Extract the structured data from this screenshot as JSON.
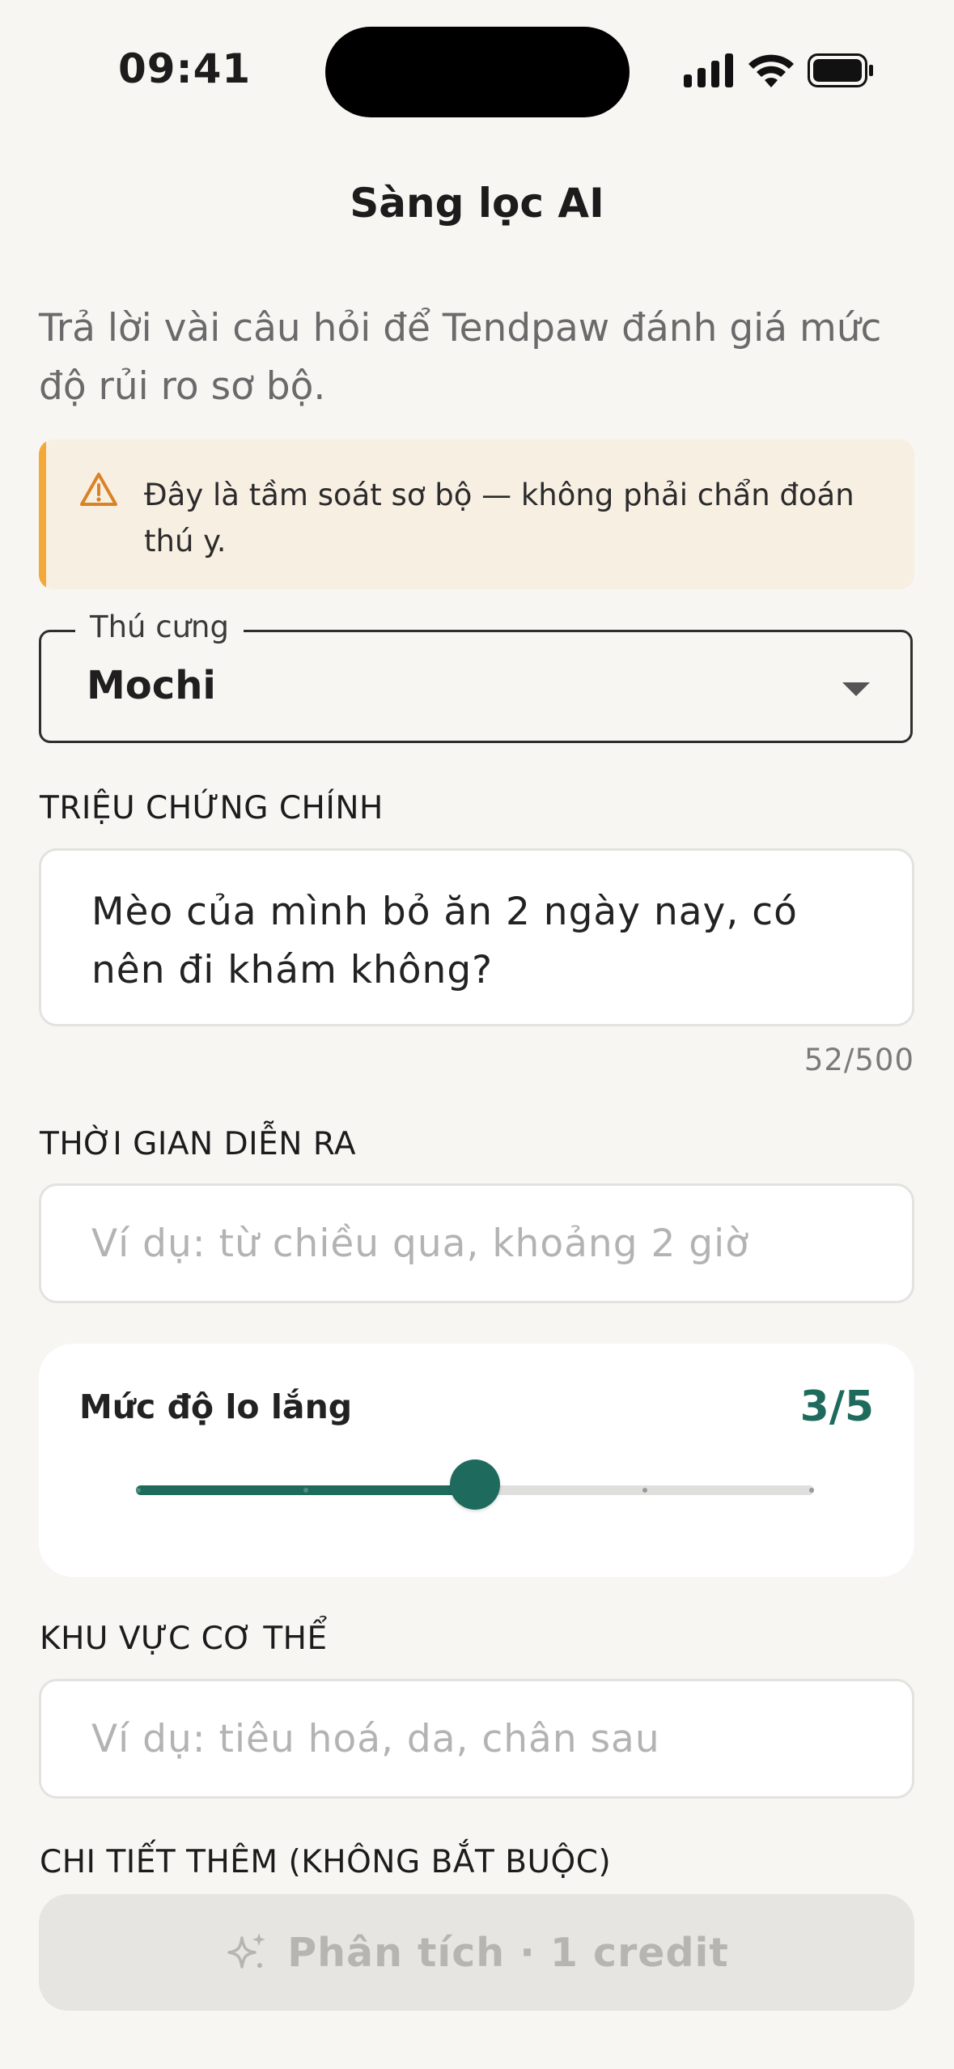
{
  "status_bar": {
    "time": "09:41"
  },
  "header": {
    "title": "Sàng lọc AI"
  },
  "intro": "Trả lời vài câu hỏi để Tendpaw đánh giá mức độ rủi ro sơ bộ.",
  "notice": {
    "icon": "warning-icon",
    "text": "Đây là tầm soát sơ bộ — không phải chẩn đoán thú y.",
    "accent": "#f3a93a"
  },
  "pet_select": {
    "label": "Thú cưng",
    "value": "Mochi"
  },
  "symptom": {
    "label": "TRIỆU CHỨNG CHÍNH",
    "value": "Mèo của mình bỏ ăn 2 ngày nay, có nên đi khám không?",
    "counter": "52/500"
  },
  "duration": {
    "label": "THỜI GIAN DIỄN RA",
    "placeholder": "Ví dụ: từ chiều qua, khoảng 2 giờ"
  },
  "worry": {
    "label": "Mức độ lo lắng",
    "value_text": "3/5",
    "value": 3,
    "max": 5,
    "accent": "#1e6b5e"
  },
  "body_area": {
    "label": "KHU VỰC CƠ THỂ",
    "placeholder": "Ví dụ: tiêu hoá, da, chân sau"
  },
  "extra": {
    "label": "CHI TIẾT THÊM (KHÔNG BẮT BUỘC)"
  },
  "cta": {
    "icon": "sparkle-icon",
    "label": "Phân tích · 1 credit"
  }
}
